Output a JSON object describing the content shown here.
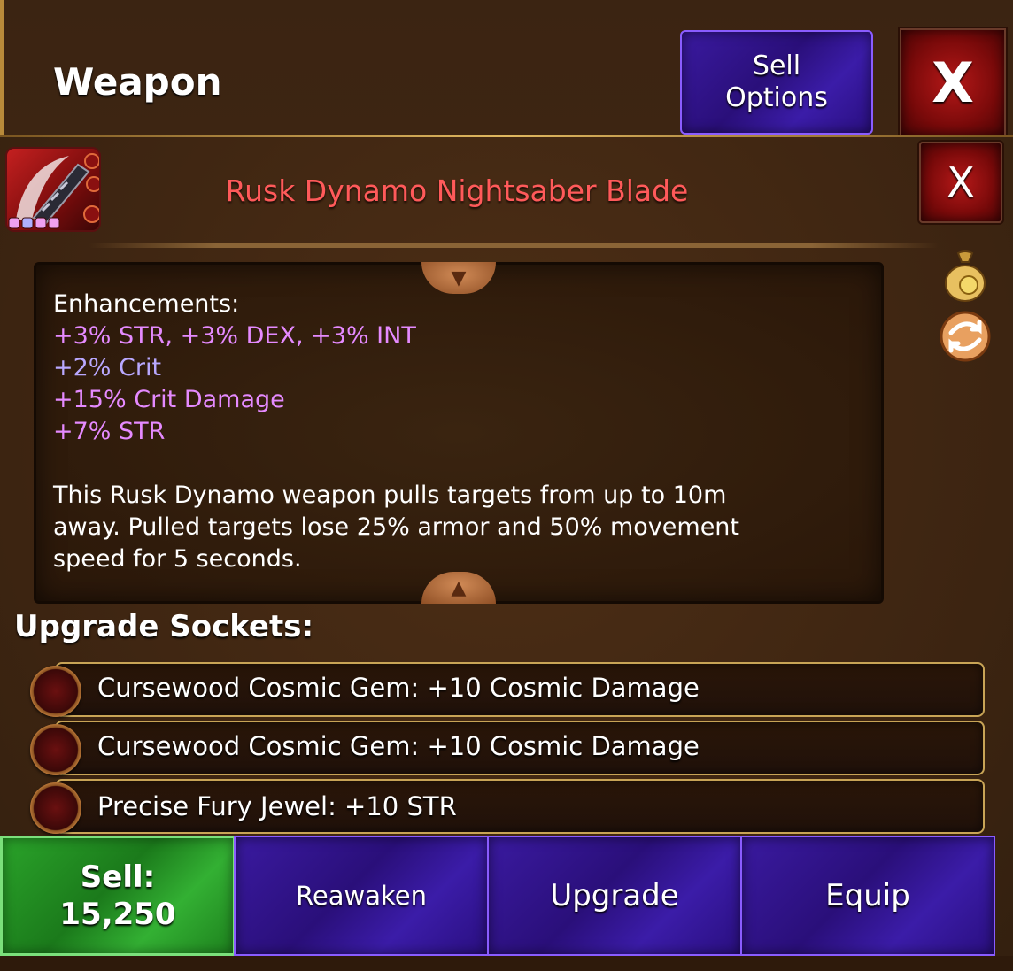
{
  "header": {
    "title": "Weapon",
    "sell_options_label": "Sell\nOptions",
    "close_label": "X"
  },
  "item": {
    "name": "Rusk Dynamo Nightsaber Blade",
    "name_color": "#ff5a5a",
    "close_label": "X"
  },
  "description": {
    "enhancements_title": "Enhancements:",
    "enhancements": [
      {
        "text": "+3% STR, +3% DEX, +3% INT",
        "color": "#e58aff"
      },
      {
        "text": "+2% Crit",
        "color": "#b9a8ff"
      },
      {
        "text": "+15% Crit Damage",
        "color": "#e58aff"
      },
      {
        "text": "+7% STR",
        "color": "#e58aff"
      }
    ],
    "flavor": "This Rusk Dynamo weapon pulls targets from up to 10m\naway. Pulled targets lose 25% armor and 50% movement\nspeed for 5 seconds."
  },
  "side_icons": [
    "moneybag-icon",
    "swap-icon"
  ],
  "sockets": {
    "title": "Upgrade Sockets:",
    "items": [
      {
        "label": "Cursewood Cosmic Gem: +10 Cosmic Damage",
        "icon": "cosmic-gem-icon"
      },
      {
        "label": "Cursewood Cosmic Gem: +10 Cosmic Damage",
        "icon": "cosmic-gem-icon"
      },
      {
        "label": "Precise Fury Jewel: +10 STR",
        "icon": "fury-jewel-icon"
      }
    ]
  },
  "actions": {
    "sell_label": "Sell:\n15,250",
    "reawaken_label": "Reawaken",
    "upgrade_label": "Upgrade",
    "equip_label": "Equip"
  }
}
